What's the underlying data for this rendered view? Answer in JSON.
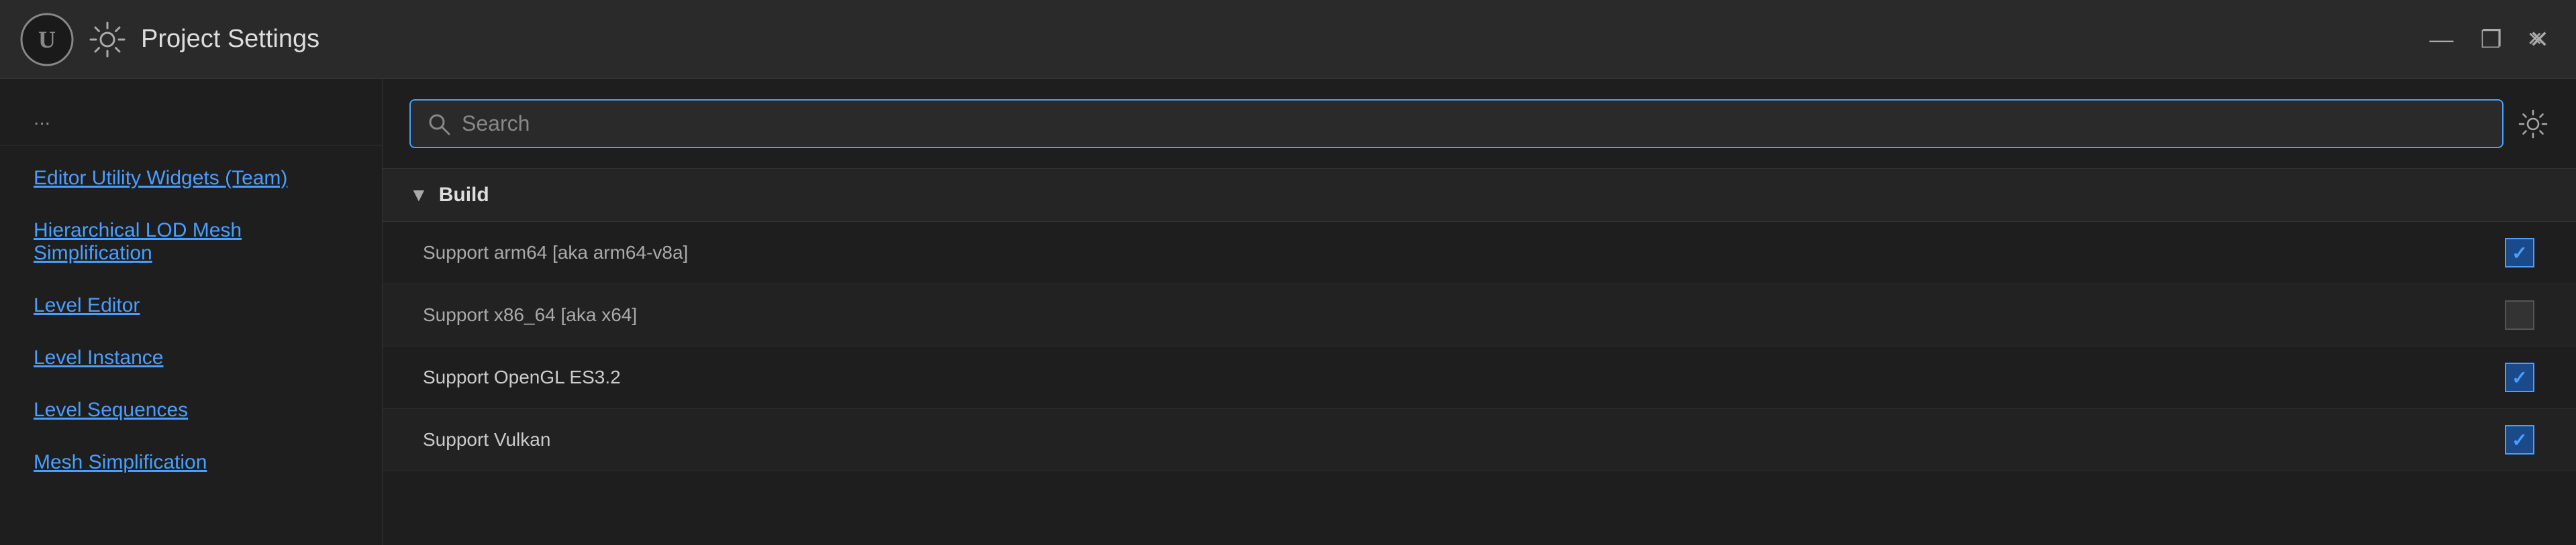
{
  "titleBar": {
    "title": "Project Settings",
    "closeLabel": "×",
    "windowControls": {
      "minimize": "—",
      "maximize": "❐",
      "close": "✕"
    }
  },
  "sidebar": {
    "truncatedTop": "...",
    "items": [
      {
        "label": "Editor Utility Widgets (Team)"
      },
      {
        "label": "Hierarchical LOD Mesh Simplification"
      },
      {
        "label": "Level Editor"
      },
      {
        "label": "Level Instance"
      },
      {
        "label": "Level Sequences"
      },
      {
        "label": "Mesh Simplification"
      }
    ]
  },
  "search": {
    "placeholder": "Search",
    "value": ""
  },
  "buildSection": {
    "title": "Build",
    "settings": [
      {
        "label": "Support arm64 [aka arm64-v8a]",
        "checked": true,
        "dim": true
      },
      {
        "label": "Support x86_64 [aka x64]",
        "checked": false,
        "dim": true
      },
      {
        "label": "Support OpenGL ES3.2",
        "checked": true,
        "dim": false
      },
      {
        "label": "Support Vulkan",
        "checked": true,
        "dim": false
      }
    ]
  }
}
